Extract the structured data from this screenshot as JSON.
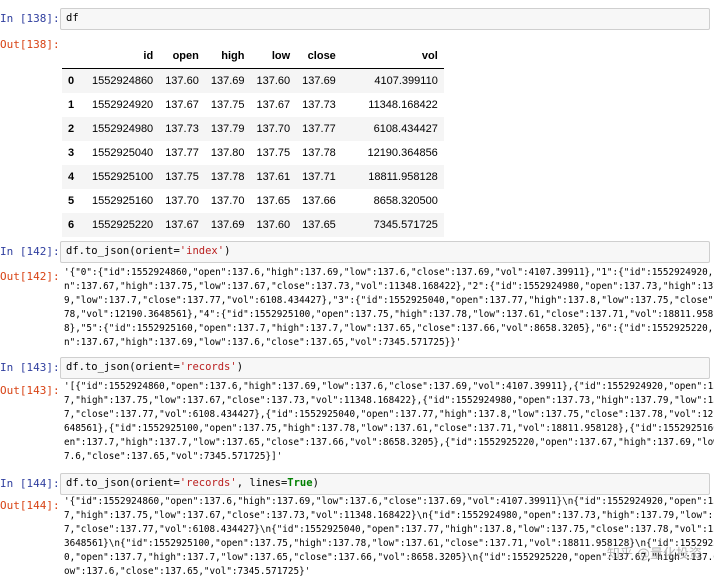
{
  "cells": [
    {
      "in_prompt": "In  [138]:",
      "out_prompt": "Out[138]:",
      "code": "df"
    },
    {
      "in_prompt": "In  [142]:",
      "out_prompt": "Out[142]:",
      "code_pre": "df.to_json(orient=",
      "code_str": "'index'",
      "code_post": ")",
      "output_lines": [
        "'{\"0\":{\"id\":1552924860,\"open\":137.6,\"high\":137.69,\"low\":137.6,\"close\":137.69,\"vol\":4107.39911},\"1\":{\"id\":1552924920,\"ope",
        "n\":137.67,\"high\":137.75,\"low\":137.67,\"close\":137.73,\"vol\":11348.168422},\"2\":{\"id\":1552924980,\"open\":137.73,\"high\":137.7",
        "9,\"low\":137.7,\"close\":137.77,\"vol\":6108.434427},\"3\":{\"id\":1552925040,\"open\":137.77,\"high\":137.8,\"low\":137.75,\"close\":137.",
        "78,\"vol\":12190.3648561},\"4\":{\"id\":1552925100,\"open\":137.75,\"high\":137.78,\"low\":137.61,\"close\":137.71,\"vol\":18811.95812",
        "8},\"5\":{\"id\":1552925160,\"open\":137.7,\"high\":137.7,\"low\":137.65,\"close\":137.66,\"vol\":8658.3205},\"6\":{\"id\":1552925220,\"ope",
        "n\":137.67,\"high\":137.69,\"low\":137.6,\"close\":137.65,\"vol\":7345.571725}}'"
      ]
    },
    {
      "in_prompt": "In  [143]:",
      "out_prompt": "Out[143]:",
      "code_pre": "df.to_json(orient=",
      "code_str": "'records'",
      "code_post": ")",
      "output_lines": [
        "'[{\"id\":1552924860,\"open\":137.6,\"high\":137.69,\"low\":137.6,\"close\":137.69,\"vol\":4107.39911},{\"id\":1552924920,\"open\":137.6",
        "7,\"high\":137.75,\"low\":137.67,\"close\":137.73,\"vol\":11348.168422},{\"id\":1552924980,\"open\":137.73,\"high\":137.79,\"low\":137.",
        "7,\"close\":137.77,\"vol\":6108.434427},{\"id\":1552925040,\"open\":137.77,\"high\":137.8,\"low\":137.75,\"close\":137.78,\"vol\":12190.3",
        "648561},{\"id\":1552925100,\"open\":137.75,\"high\":137.78,\"low\":137.61,\"close\":137.71,\"vol\":18811.958128},{\"id\":1552925160,\"op",
        "en\":137.7,\"high\":137.7,\"low\":137.65,\"close\":137.66,\"vol\":8658.3205},{\"id\":1552925220,\"open\":137.67,\"high\":137.69,\"low\":13",
        "7.6,\"close\":137.65,\"vol\":7345.571725}]'"
      ]
    },
    {
      "in_prompt": "In  [144]:",
      "out_prompt": "Out[144]:",
      "code_pre": "df.to_json(orient=",
      "code_str": "'records'",
      "code_mid": ", lines=",
      "code_kw": "True",
      "code_post": ")",
      "output_lines": [
        "'{\"id\":1552924860,\"open\":137.6,\"high\":137.69,\"low\":137.6,\"close\":137.69,\"vol\":4107.39911}\\n{\"id\":1552924920,\"open\":137.6",
        "7,\"high\":137.75,\"low\":137.67,\"close\":137.73,\"vol\":11348.168422}\\n{\"id\":1552924980,\"open\":137.73,\"high\":137.79,\"low\":137.",
        "7,\"close\":137.77,\"vol\":6108.434427}\\n{\"id\":1552925040,\"open\":137.77,\"high\":137.8,\"low\":137.75,\"close\":137.78,\"vol\":12190.",
        "3648561}\\n{\"id\":1552925100,\"open\":137.75,\"high\":137.78,\"low\":137.61,\"close\":137.71,\"vol\":18811.958128}\\n{\"id\":155292516",
        "0,\"open\":137.7,\"high\":137.7,\"low\":137.65,\"close\":137.66,\"vol\":8658.3205}\\n{\"id\":1552925220,\"open\":137.67,\"high\":137.69,\"l",
        "ow\":137.6,\"close\":137.65,\"vol\":7345.571725}'"
      ]
    }
  ],
  "dataframe": {
    "columns": [
      "id",
      "open",
      "high",
      "low",
      "close",
      "vol"
    ],
    "rows": [
      {
        "index": "0",
        "cells": [
          "1552924860",
          "137.60",
          "137.69",
          "137.60",
          "137.69",
          "4107.399110"
        ]
      },
      {
        "index": "1",
        "cells": [
          "1552924920",
          "137.67",
          "137.75",
          "137.67",
          "137.73",
          "11348.168422"
        ]
      },
      {
        "index": "2",
        "cells": [
          "1552924980",
          "137.73",
          "137.79",
          "137.70",
          "137.77",
          "6108.434427"
        ]
      },
      {
        "index": "3",
        "cells": [
          "1552925040",
          "137.77",
          "137.80",
          "137.75",
          "137.78",
          "12190.364856"
        ]
      },
      {
        "index": "4",
        "cells": [
          "1552925100",
          "137.75",
          "137.78",
          "137.61",
          "137.71",
          "18811.958128"
        ]
      },
      {
        "index": "5",
        "cells": [
          "1552925160",
          "137.70",
          "137.70",
          "137.65",
          "137.66",
          "8658.320500"
        ]
      },
      {
        "index": "6",
        "cells": [
          "1552925220",
          "137.67",
          "137.69",
          "137.60",
          "137.65",
          "7345.571725"
        ]
      }
    ]
  },
  "watermark": "知乎 @量化投资"
}
